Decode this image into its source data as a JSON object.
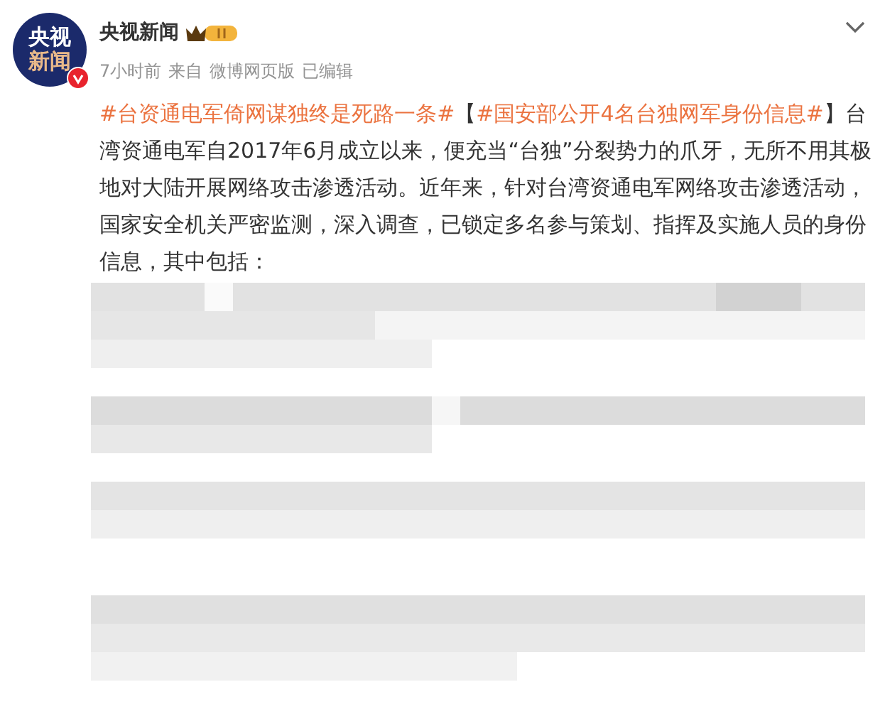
{
  "author": {
    "avatar_text": [
      "央视",
      "新闻"
    ],
    "verified": true,
    "name": "央视新闻",
    "meta": [
      "7小时前",
      "来自",
      "微博网页版",
      "已编辑"
    ]
  },
  "post": {
    "parts": [
      {
        "kind": "topic",
        "text": "#台资通电军倚网谋独终是死路一条#"
      },
      {
        "kind": "plain",
        "text": "【"
      },
      {
        "kind": "topic",
        "text": "#国安部公开4名台独网军身份信息#"
      },
      {
        "kind": "plain",
        "text": "】台湾资通电军自2017年6月成立以来，便充当“台独”分裂势力的爪牙，无所不用其极地对大陆开展网络攻击渗透活动。近年来，针对台湾资通电军网络攻击渗透活动，国家安全机关严密监测，深入调查，已锁定多名参与策划、指挥及实施人员的身份信息，其中包括："
      }
    ]
  }
}
